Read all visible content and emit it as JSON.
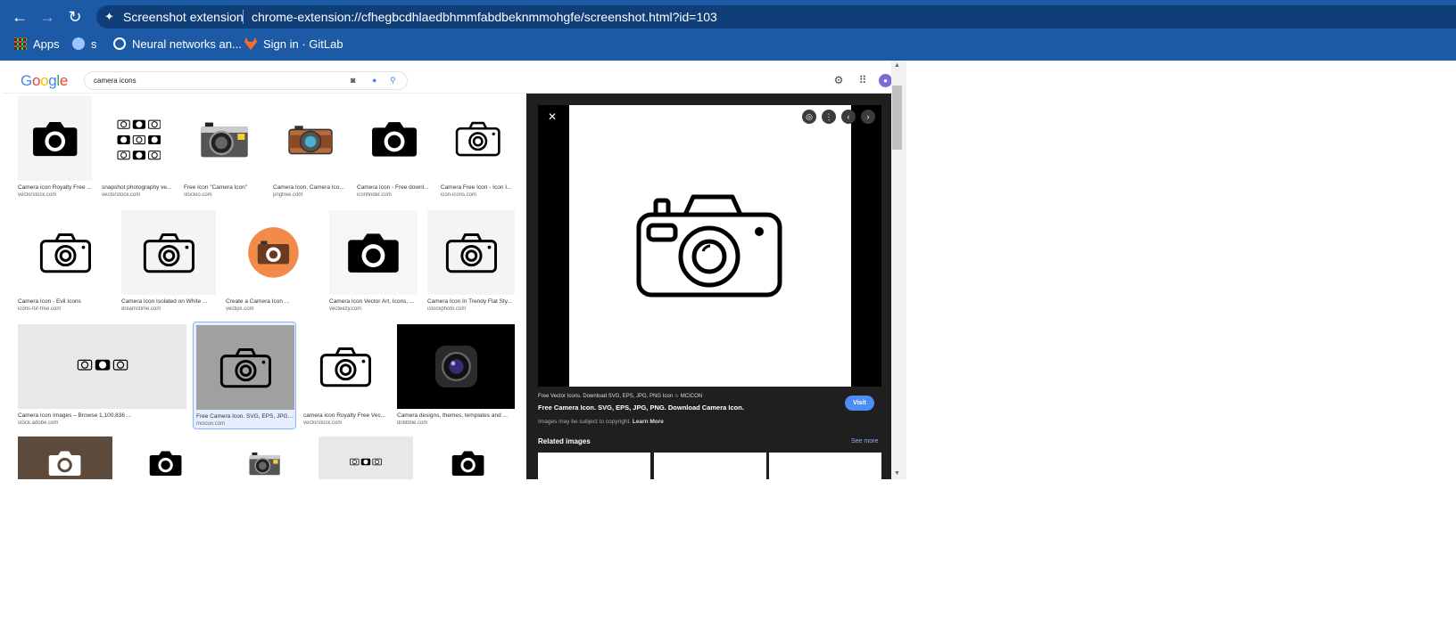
{
  "browser": {
    "tab_title": "Screenshot extension",
    "url": "chrome-extension://cfhegbcdhlaedbhmmfabdbeknmmohgfe/screenshot.html?id=103",
    "bookmarks": [
      "Apps",
      "s",
      "Neural networks an...",
      "Sign in · GitLab"
    ]
  },
  "search": {
    "logo": "Google",
    "query": "camera icons"
  },
  "results": [
    {
      "title": "Camera icon Royalty Free ...",
      "source": "vectorstock.com",
      "icon": "camera-filled-icon"
    },
    {
      "title": "snapshot photography ve...",
      "source": "vectorstock.com",
      "icon": "camera-grid-icon"
    },
    {
      "title": "Free Icon \"Camera Icon\"",
      "source": "stockio.com",
      "icon": "retro-camera-icon"
    },
    {
      "title": "Camera Icon, Camera Ico...",
      "source": "pngtree.com",
      "icon": "brown-camera-icon"
    },
    {
      "title": "Camera Icon - Free downl...",
      "source": "iconfinder.com",
      "icon": "camera-filled-icon"
    },
    {
      "title": "Camera Free Icon - Icon I...",
      "source": "icon-icons.com",
      "icon": "camera-outline-icon"
    },
    {
      "title": "Camera Icon - Evil Icons",
      "source": "icons-for-free.com",
      "icon": "camera-outline-icon"
    },
    {
      "title": "Camera Icon Isolated on White ...",
      "source": "dreamstime.com",
      "icon": "camera-outline-icon"
    },
    {
      "title": "Create a Camera Icon ...",
      "source": "vectips.com",
      "icon": "orange-camera-icon"
    },
    {
      "title": "Camera Icon Vector Art, Icons, ...",
      "source": "vecteezy.com",
      "icon": "camera-filled-icon"
    },
    {
      "title": "Camera Icon In Trendy Flat Sty...",
      "source": "istockphoto.com",
      "icon": "camera-outline-icon"
    },
    {
      "title": "Camera Icon Images – Browse 1,100,836 ...",
      "source": "stock.adobe.com",
      "icon": "camera-set-icon"
    },
    {
      "title": "Free Camera Icon. SVG, EPS, JPG, ...",
      "source": "mcicon.com",
      "icon": "camera-outline-icon"
    },
    {
      "title": "camera icon Royalty Free Vec...",
      "source": "vectorstock.com",
      "icon": "camera-outline-icon"
    },
    {
      "title": "Camera designs, themes, templates and ...",
      "source": "dribbble.com",
      "icon": "lens-app-icon"
    },
    {
      "title": "",
      "source": "",
      "icon": "camera-white-icon"
    },
    {
      "title": "",
      "source": "",
      "icon": "camera-filled-icon"
    },
    {
      "title": "",
      "source": "",
      "icon": "retro-camera-icon"
    },
    {
      "title": "",
      "source": "",
      "icon": "camera-set-icon"
    },
    {
      "title": "",
      "source": "",
      "icon": "camera-filled-icon"
    }
  ],
  "preview": {
    "source_line": "Free Vector Icons. Download SVG, EPS, JPG, PNG Icon ☆ MCICON",
    "title": "Free Camera Icon. SVG, EPS, JPG, PNG. Download Camera Icon.",
    "visit": "Visit",
    "copyright": "Images may be subject to copyright.",
    "learn_more": "Learn More",
    "related_title": "Related images",
    "see_more": "See more"
  }
}
